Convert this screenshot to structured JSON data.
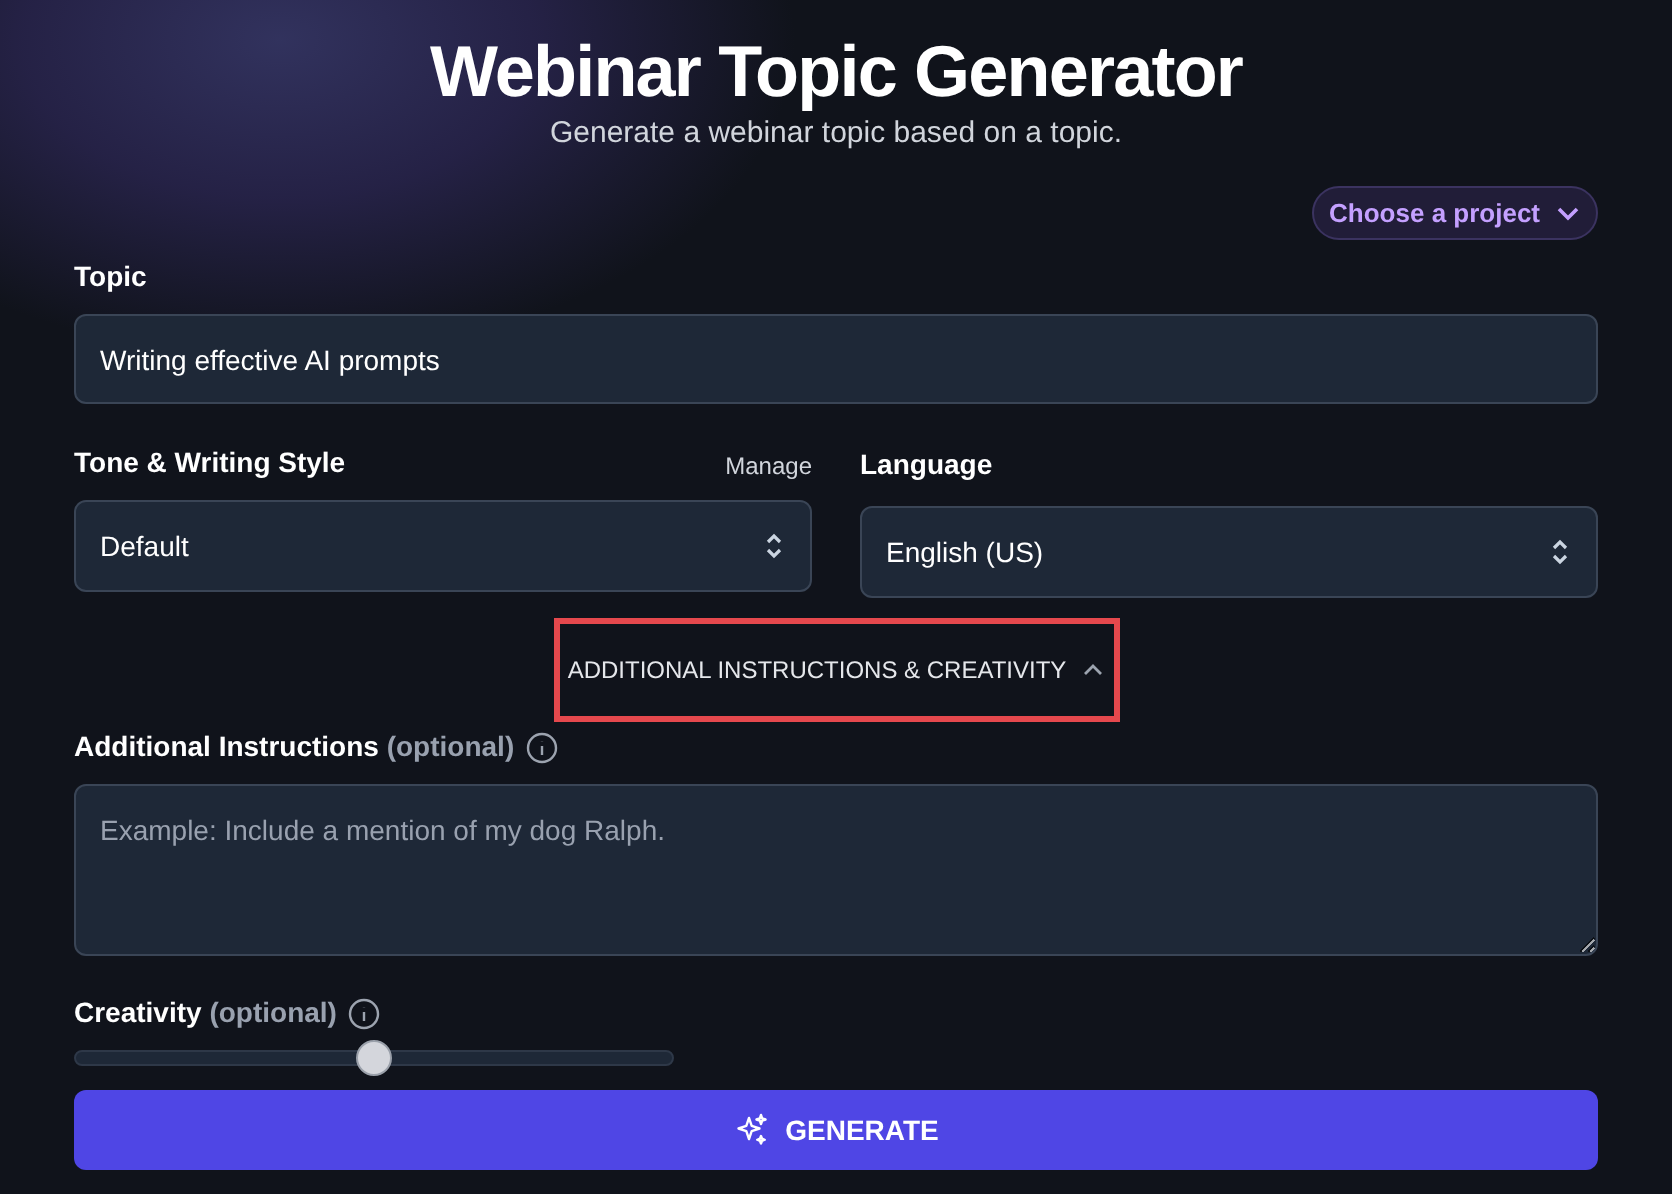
{
  "header": {
    "title": "Webinar Topic Generator",
    "subtitle": "Generate a webinar topic based on a topic."
  },
  "project_picker": {
    "label": "Choose a project"
  },
  "topic": {
    "label": "Topic",
    "value": "Writing effective AI prompts"
  },
  "tone": {
    "label": "Tone & Writing Style",
    "link": "Manage",
    "value": "Default"
  },
  "language": {
    "label": "Language",
    "value": "English (US)"
  },
  "toggle": {
    "label": "ADDITIONAL INSTRUCTIONS & CREATIVITY",
    "expanded": true,
    "highlighted": true
  },
  "instructions": {
    "label": "Additional Instructions",
    "hint": "(optional)",
    "placeholder": "Example: Include a mention of my dog Ralph."
  },
  "creativity": {
    "label": "Creativity",
    "hint": "(optional)",
    "level": 0.5
  },
  "generate_button": {
    "label": "GENERATE"
  }
}
